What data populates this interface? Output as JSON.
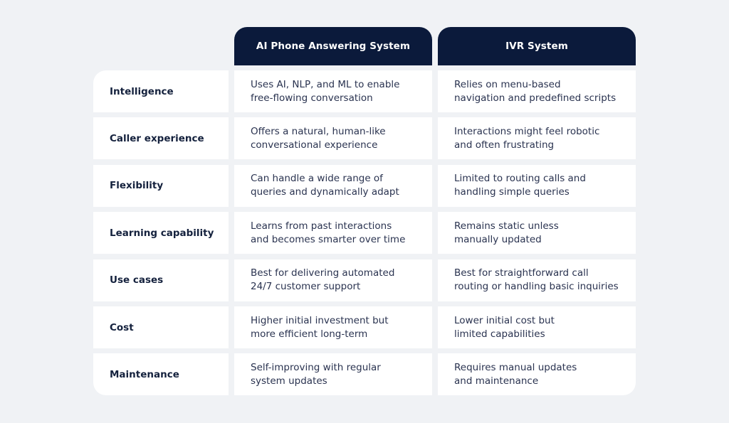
{
  "table": {
    "columns": [
      "AI Phone Answering System",
      "IVR System"
    ],
    "rows": [
      {
        "label": "Intelligence",
        "ai": "Uses AI, NLP, and ML to enable\nfree-flowing conversation",
        "ivr": "Relies on menu-based\nnavigation and predefined scripts"
      },
      {
        "label": "Caller experience",
        "ai": "Offers a natural, human-like\nconversational experience",
        "ivr": "Interactions might feel robotic\nand often frustrating"
      },
      {
        "label": "Flexibility",
        "ai": "Can handle a wide range of\nqueries and dynamically adapt",
        "ivr": "Limited to routing calls and\nhandling simple queries"
      },
      {
        "label": "Learning capability",
        "ai": "Learns from past interactions\nand becomes smarter over time",
        "ivr": "Remains static unless\nmanually updated"
      },
      {
        "label": "Use cases",
        "ai": "Best for delivering automated\n24/7 customer support",
        "ivr": "Best for straightforward call\nrouting or handling basic inquiries"
      },
      {
        "label": "Cost",
        "ai": "Higher initial investment but\nmore efficient long-term",
        "ivr": "Lower initial cost but\nlimited capabilities"
      },
      {
        "label": "Maintenance",
        "ai": "Self-improving with regular\nsystem updates",
        "ivr": "Requires manual updates\nand maintenance"
      }
    ]
  },
  "colors": {
    "header_bg": "#0b1a3b",
    "page_bg": "#f0f2f5",
    "cell_bg": "#ffffff"
  }
}
